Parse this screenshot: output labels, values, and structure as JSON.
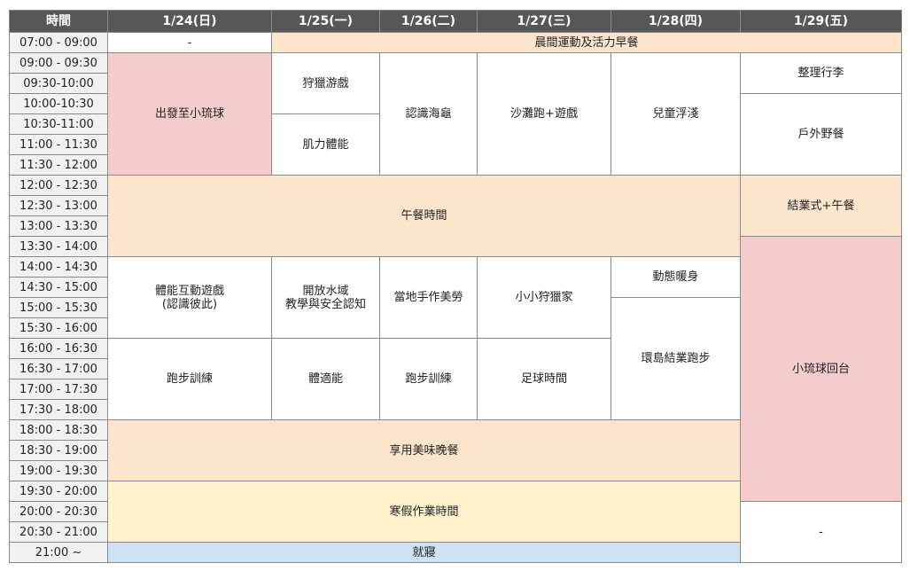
{
  "headers": [
    "時間",
    "1/24(日)",
    "1/25(一)",
    "1/26(二)",
    "1/27(三)",
    "1/28(四)",
    "1/29(五)"
  ],
  "times": [
    "07:00 - 09:00",
    "09:00 - 09:30",
    "09:30-10:00",
    "10:00-10:30",
    "10:30-11:00",
    "11:00 - 11:30",
    "11:30 - 12:00",
    "12:00 - 12:30",
    "12:30 - 13:00",
    "13:00 - 13:30",
    "13:30 - 14:00",
    "14:00 - 14:30",
    "14:30 - 15:00",
    "15:00 - 15:30",
    "15:30 - 16:00",
    "16:00 - 16:30",
    "16:30 - 17:00",
    "17:00 - 17:30",
    "17:30 - 18:00",
    "18:00 - 18:30",
    "18:30 - 19:00",
    "19:00 - 19:30",
    "19:30 - 20:00",
    "20:00 - 20:30",
    "20:30 - 21:00",
    "21:00 ~"
  ],
  "events": {
    "d24_morning_dash": "-",
    "morning_exercise": "晨間運動及活力早餐",
    "depart": "出發至小琉球",
    "hunt_game": "狩獵游戲",
    "muscle": "肌力體能",
    "turtle": "認識海龜",
    "beach_run": "沙灘跑+遊戲",
    "snorkel": "兒童浮淺",
    "pack": "整理行李",
    "picnic": "戶外野餐",
    "lunch": "午餐時間",
    "closing_lunch": "結業式+午餐",
    "fitness_game_1": "體能互動遊戲",
    "fitness_game_2": "(認識彼此)",
    "open_water_1": "開放水域",
    "open_water_2": "教學與安全認知",
    "craft": "當地手作美勞",
    "little_hunter": "小小狩獵家",
    "warmup": "動態暖身",
    "island_run": "環島結業跑步",
    "return": "小琉球回台",
    "run_training_24": "跑步訓練",
    "body_fit": "體適能",
    "run_training_26": "跑步訓練",
    "football": "足球時間",
    "dinner": "享用美味晚餐",
    "homework": "寒假作業時間",
    "d29_evening_dash": "-",
    "sleep": "就寢"
  }
}
